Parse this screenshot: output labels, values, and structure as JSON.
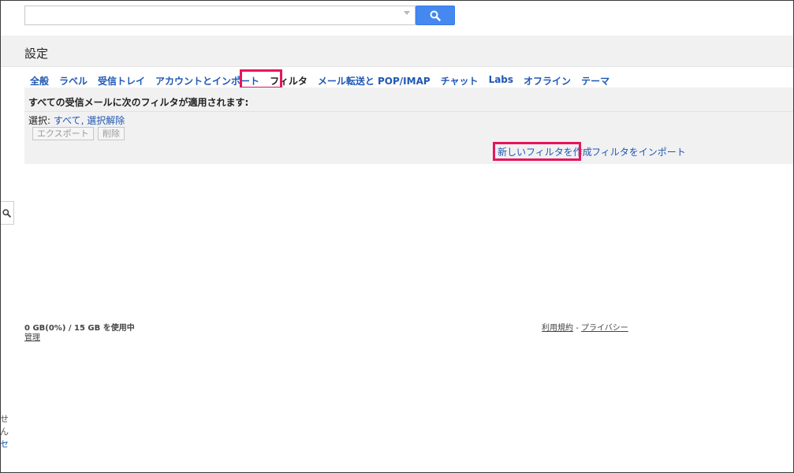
{
  "search": {
    "placeholder": "",
    "value": ""
  },
  "page_title": "設定",
  "tabs": [
    {
      "label": "全般"
    },
    {
      "label": "ラベル"
    },
    {
      "label": "受信トレイ"
    },
    {
      "label": "アカウントとインポート"
    },
    {
      "label": "フィルタ",
      "active": true
    },
    {
      "label": "メール転送と POP/IMAP"
    },
    {
      "label": "チャット"
    },
    {
      "label": "Labs"
    },
    {
      "label": "オフライン"
    },
    {
      "label": "テーマ"
    }
  ],
  "filters": {
    "heading": "すべての受信メールに次のフィルタが適用されます:",
    "select_label": "選択:",
    "select_all": "すべて",
    "select_sep": ",",
    "select_none": "選択解除",
    "export_button": "エクスポート",
    "delete_button": "削除",
    "create_link": "新しいフィルタを作成",
    "import_link": "フィルタをインポート"
  },
  "footer": {
    "storage": "0 GB(0%) / 15 GB を使用中",
    "manage": "管理",
    "terms": "利用規約",
    "sep": "-",
    "privacy": "プライバシー"
  },
  "left_partial": {
    "line1": "せん",
    "line2": "セ"
  },
  "colors": {
    "accent": "#4488f0",
    "link": "#1f57b5",
    "highlight": "#e6155f"
  }
}
